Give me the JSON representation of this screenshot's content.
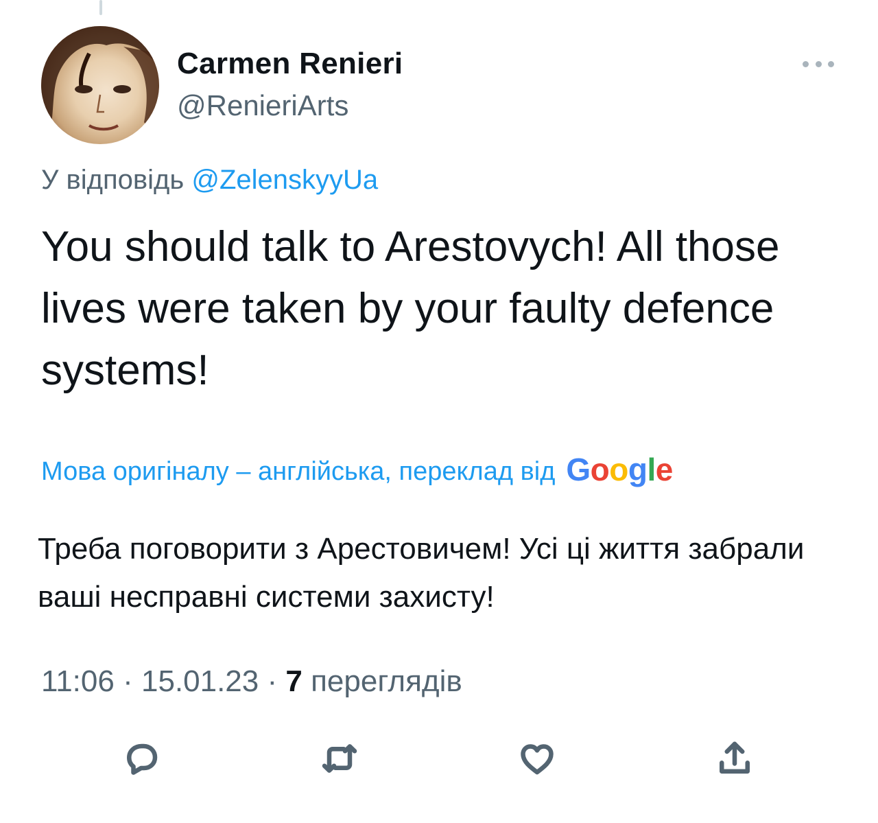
{
  "tweet": {
    "author": {
      "display_name": "Carmen Renieri",
      "handle": "@RenieriArts"
    },
    "reply_to": {
      "prefix": "У відповідь",
      "mention": "@ZelenskyyUa"
    },
    "text": "You should talk to Arestovych! All those lives were taken by your faulty defence systems!",
    "translation_note": "Мова оригіналу – англійська, переклад від",
    "translation_provider": "Google",
    "translation": "Треба поговорити з Арестовичем! Усі ці життя забрали ваші несправні системи захисту!",
    "time": "11:06",
    "separator": "·",
    "date": "15.01.23",
    "views_count": "7",
    "views_label": "переглядів"
  },
  "icons": {
    "more": "more-horizontal-icon",
    "reply": "reply-icon",
    "retweet": "retweet-icon",
    "like": "like-icon",
    "share": "share-icon"
  },
  "colors": {
    "accent": "#1d9bf0",
    "text_primary": "#0f1419",
    "text_secondary": "#536471",
    "google_blue": "#4285f4",
    "google_red": "#ea4335",
    "google_yellow": "#fbbc05",
    "google_green": "#34a853"
  }
}
